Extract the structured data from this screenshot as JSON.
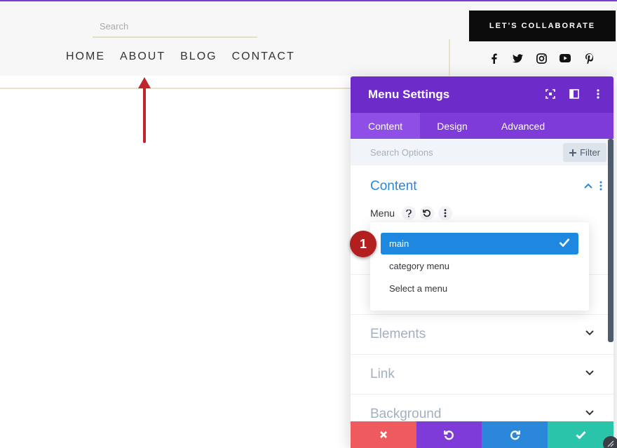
{
  "site": {
    "search_placeholder": "Search",
    "nav": [
      "HOME",
      "ABOUT",
      "BLOG",
      "CONTACT"
    ],
    "cta_label": "LET'S COLLABORATE",
    "social_icons": [
      "facebook-icon",
      "twitter-icon",
      "instagram-icon",
      "youtube-icon",
      "pinterest-icon"
    ]
  },
  "panel": {
    "title": "Menu Settings",
    "tabs": [
      {
        "label": "Content",
        "active": true
      },
      {
        "label": "Design",
        "active": false
      },
      {
        "label": "Advanced",
        "active": false
      }
    ],
    "search_placeholder": "Search Options",
    "filter_label": "Filter",
    "content_section": {
      "title": "Content",
      "menu_label": "Menu"
    },
    "dropdown": {
      "options": [
        "main",
        "category menu",
        "Select a menu"
      ],
      "selected": "main"
    },
    "sections": [
      "Elements",
      "Link",
      "Background"
    ]
  },
  "annotation": {
    "step": "1"
  },
  "colors": {
    "panel_header": "#6d2bc9",
    "tabs": "#7e3bd8",
    "accent_blue": "#2b87da",
    "cancel": "#ef5a5f",
    "save": "#29c4a9",
    "badge": "#b31e1e"
  }
}
